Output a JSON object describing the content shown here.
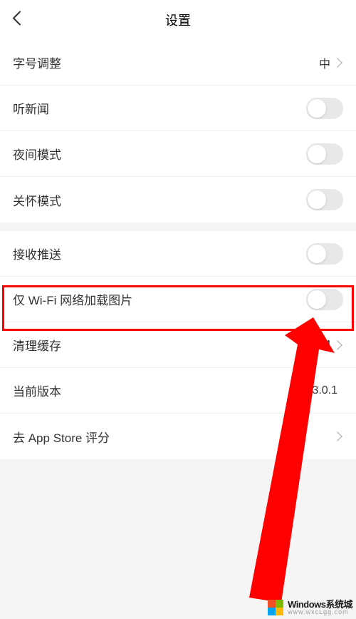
{
  "header": {
    "title": "设置"
  },
  "sections": {
    "font_adjust": {
      "label": "字号调整",
      "value": "中"
    },
    "listen_news": {
      "label": "听新闻"
    },
    "night_mode": {
      "label": "夜间模式"
    },
    "care_mode": {
      "label": "关怀模式"
    },
    "push": {
      "label": "接收推送"
    },
    "wifi_images": {
      "label": "仅 Wi-Fi 网络加载图片"
    },
    "clear_cache": {
      "label": "清理缓存",
      "value": "1.1 M"
    },
    "version": {
      "label": "当前版本",
      "value": "13.0.1"
    },
    "rate": {
      "label": "去 App Store 评分"
    }
  },
  "watermark": {
    "line1": "Windows系统城",
    "line2": "www.wxcLgg.com"
  }
}
